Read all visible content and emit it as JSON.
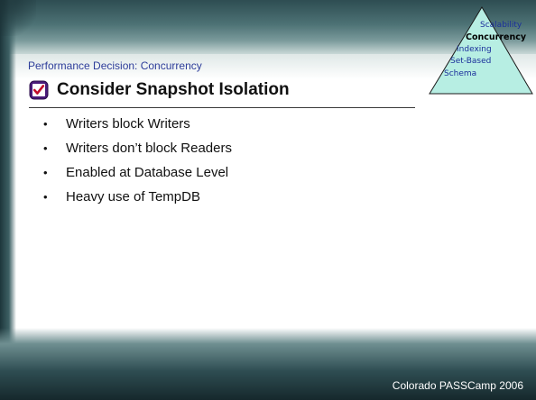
{
  "header": {
    "subtitle": "Performance Decision: Concurrency",
    "title": "Consider Snapshot Isolation"
  },
  "bullets": [
    "Writers block Writers",
    "Writers don’t block Readers",
    "Enabled at Database Level",
    "Heavy use of TempDB"
  ],
  "pyramid": {
    "labels": [
      "Scalability",
      "Concurrency",
      "Indexing",
      "Set-Based",
      "Schema"
    ],
    "highlighted": "Concurrency"
  },
  "footer": {
    "text": "Colorado PASSCamp 2006"
  },
  "colors": {
    "accent_blue": "#2d3d9a",
    "pyramid_fill": "#b7eee3",
    "check_red": "#c20e2b"
  }
}
